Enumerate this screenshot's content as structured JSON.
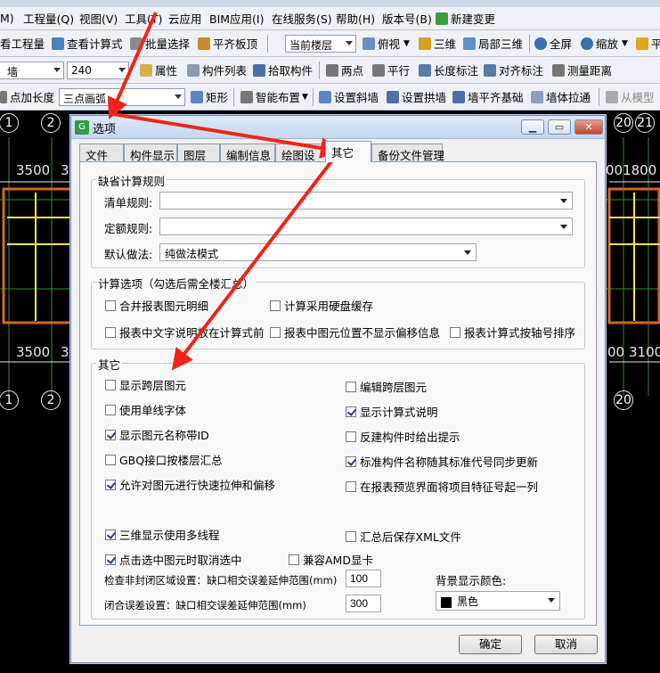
{
  "menubar": {
    "items": [
      "M)",
      "工程量(Q)",
      "视图(V)",
      "工具(T)",
      "云应用",
      "BIM应用(I)",
      "在线服务(S)",
      "帮助(H)",
      "版本号(B)",
      "新建变更"
    ]
  },
  "toolbar1": {
    "view_engineering": "看工程量",
    "view_formula": "查看计算式",
    "batch_select": "批量选择",
    "level_board": "平齐板顶",
    "floor_select": "当前楼层",
    "top_view": "俯视",
    "three_d": "三维",
    "local_3d": "局部三维",
    "full_screen": "全屏",
    "zoom": "缩放",
    "pan": "平"
  },
  "toolbar2": {
    "type_select": "墙",
    "size_select": "240",
    "properties": "属性",
    "component_list": "构件列表",
    "pick_component": "拾取构件",
    "two_points": "两点",
    "parallel": "平行",
    "length_dim": "长度标注",
    "align_dim": "对齐标注",
    "measure_distance": "测量距离"
  },
  "toolbar3": {
    "point_length": "点加长度",
    "three_point_arc": "三点画弧",
    "rectangle": "矩形",
    "smart_layout": "智能布置",
    "set_slope_wall": "设置斜墙",
    "set_arch_wall": "设置拱墙",
    "wall_level_foundation": "墙平齐基础",
    "wall_stretch": "墙体拉通",
    "from_model": "从模型"
  },
  "canvas": {
    "axis_top": [
      "1",
      "2",
      "20",
      "21"
    ],
    "axis_bottom": [
      "1",
      "2",
      "20"
    ],
    "dim_top_left": "3500",
    "dim_top_left2": "3",
    "dim_top_right": "001800",
    "dim_bottom_left": "3500",
    "dim_bottom_left2": "3",
    "dim_bottom_right": "00",
    "dim_bottom_right2": "3100"
  },
  "dialog": {
    "title": "选项",
    "tabs": [
      "文件",
      "构件显示",
      "图层",
      "编制信息",
      "绘图设",
      "其它",
      "备份文件管理"
    ],
    "active_tab": "其它",
    "group_default_rules": {
      "label": "缺省计算规则",
      "list_rule_label": "清单规则:",
      "list_rule_value": "",
      "quota_rule_label": "定额规则:",
      "quota_rule_value": "",
      "default_method_label": "默认做法:",
      "default_method_value": "纯做法模式"
    },
    "group_calc_options": {
      "label": "计算选项（勾选后需全楼汇总）",
      "merge_report": "合并报表图元明细",
      "disk_cache": "计算采用硬盘缓存",
      "text_before_formula": "报表中文字说明放在计算式前",
      "hide_offset": "报表中图元位置不显示偏移信息",
      "sort_by_axis": "报表计算式按轴号排序"
    },
    "group_other": {
      "label": "其它",
      "show_cross_floor": "显示跨层图元",
      "edit_cross_floor": "编辑跨层图元",
      "single_line_font": "使用单线字体",
      "show_formula_desc": "显示计算式说明",
      "show_name_with_id": "显示图元名称带ID",
      "reverse_build_hint": "反建构件时给出提示",
      "gbq_summary": "GBQ接口按楼层汇总",
      "sync_standard_name": "标准构件名称随其标准代号同步更新",
      "allow_quick_stretch": "允许对图元进行快速拉伸和偏移",
      "collapse_project_features": "在报表预览界面将项目特征号起一列",
      "multithread_3d": "三维显示使用多线程",
      "save_xml": "汇总后保存XML文件",
      "cancel_selection_on_click": "点击选中图元时取消选中",
      "amd_compat": "兼容AMD显卡",
      "check_unclosed_label": "检查非封闭区域设置：缺口相交误差延伸范围(mm)",
      "check_unclosed_value": "100",
      "closure_error_label": "闭合误差设置：缺口相交误差延伸范围(mm)",
      "closure_error_value": "300",
      "bg_color_label": "背景显示颜色:",
      "bg_color_value": "黑色"
    },
    "ok_label": "确定",
    "cancel_label": "取消"
  },
  "colors": {
    "annotation_arrow": "#f02418",
    "canvas_bg": "#000000",
    "wall_orange": "#d2691e",
    "wall_yellow": "#f5e24a",
    "checkbox_check": "#1e3c8c"
  }
}
